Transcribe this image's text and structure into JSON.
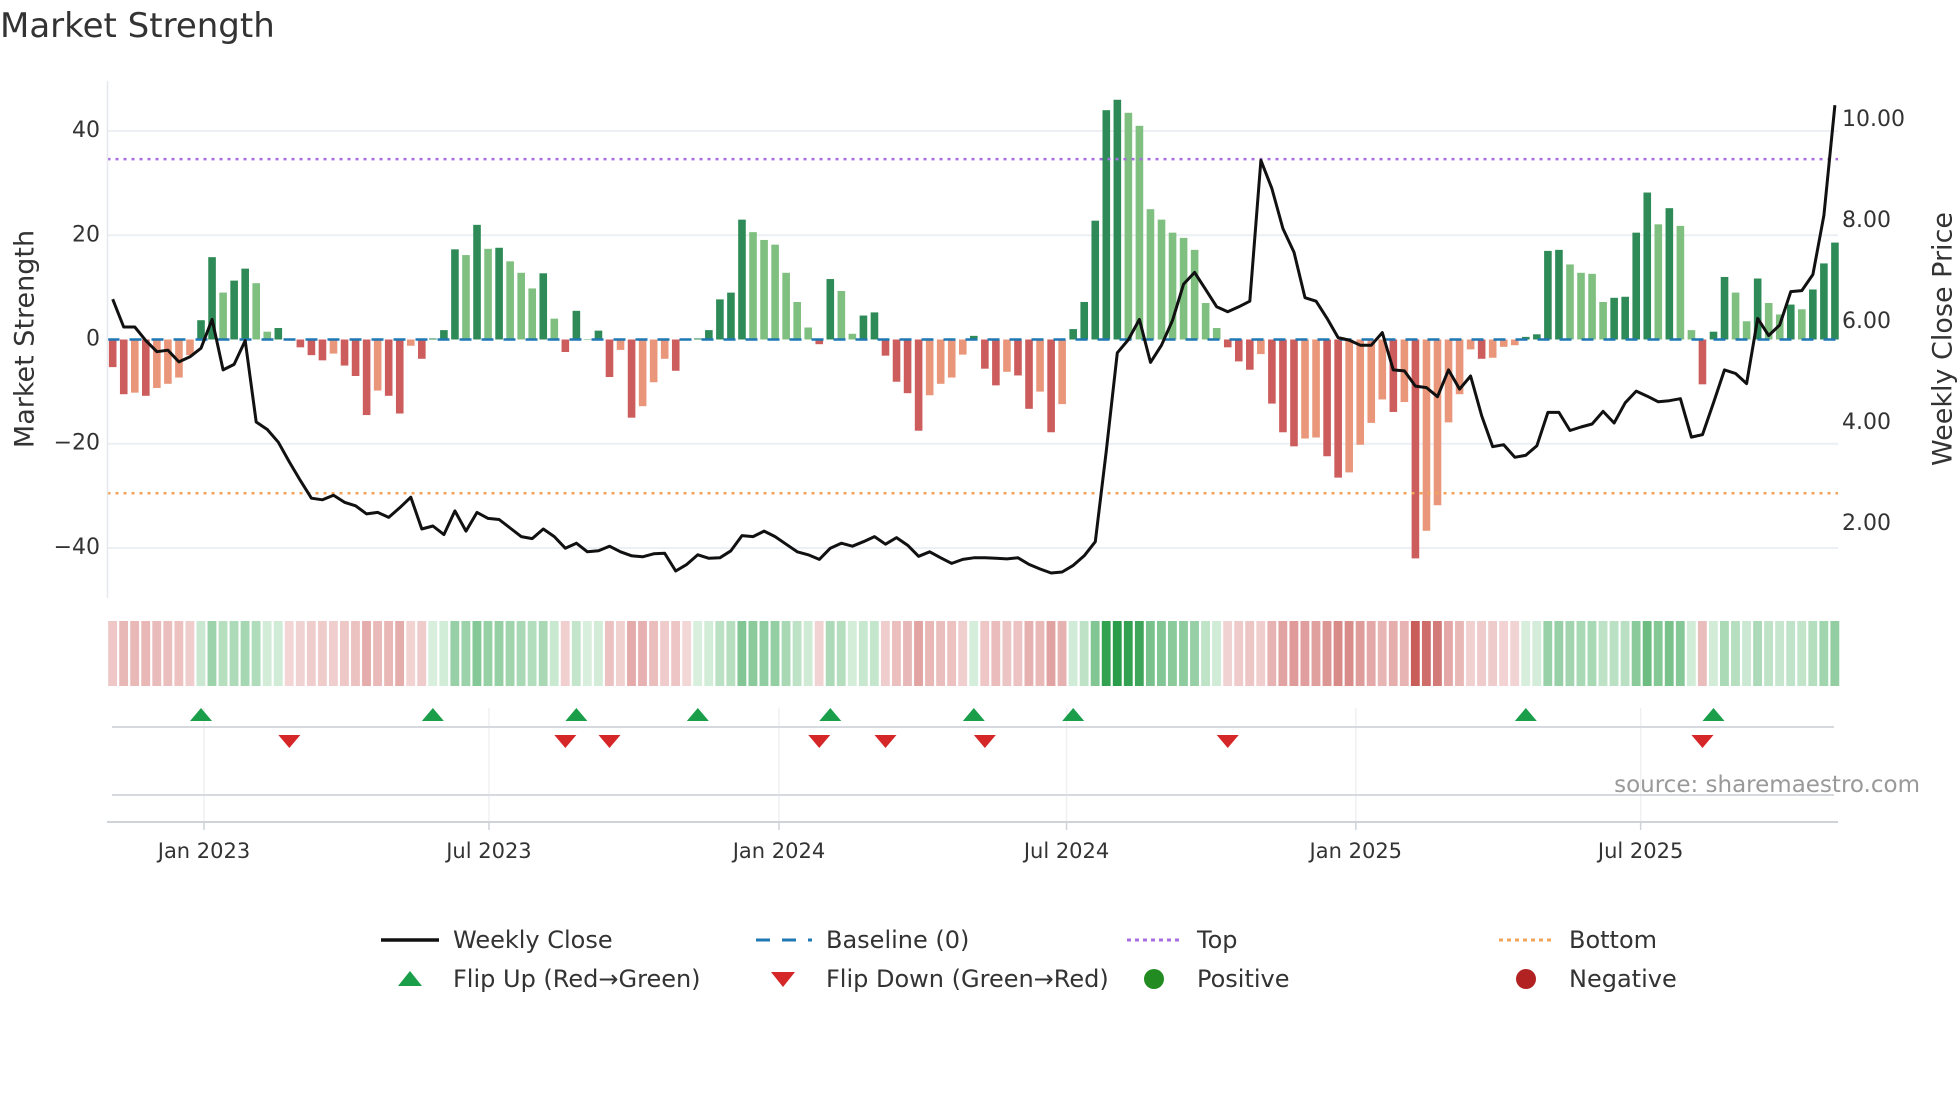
{
  "chart_data": {
    "type": "bar",
    "title": "Market Strength",
    "ylabel": "Market Strength",
    "y2label": "Weekly Close Price",
    "ylim": [
      -49.6,
      49.6
    ],
    "y2lim": [
      0.535,
      10.77
    ],
    "yticks": [
      40,
      20,
      0,
      -20,
      -40
    ],
    "ytick_labels": [
      "40",
      "20",
      "0",
      "−20",
      "−40"
    ],
    "y2ticks": [
      10,
      8,
      6,
      4,
      2
    ],
    "y2tick_labels": [
      "10.00",
      "8.00",
      "6.00",
      "4.00",
      "2.00"
    ],
    "x_unit": "week index (0 = first week shown)",
    "x_ticks": [
      {
        "label": "Jan 2023",
        "week": 8.27
      },
      {
        "label": "Jul 2023",
        "week": 34.08
      },
      {
        "label": "Jan 2024",
        "week": 60.35
      },
      {
        "label": "Jul 2024",
        "week": 86.4
      },
      {
        "label": "Jan 2025",
        "week": 112.6
      },
      {
        "label": "Jul 2025",
        "week": 138.4
      }
    ],
    "top_level": 34.6,
    "bottom_level": -29.5,
    "baseline": 0,
    "strength": [
      -5.3,
      -10.5,
      -10.2,
      -10.8,
      -9.3,
      -8.5,
      -7.3,
      -3,
      3.7,
      15.8,
      9,
      11.3,
      13.6,
      10.8,
      1.5,
      2.2,
      -0.2,
      -1.5,
      -3,
      -4,
      -2.7,
      -5,
      -7,
      -14.5,
      -9.8,
      -10.8,
      -14.2,
      -1.2,
      -3.7,
      0.2,
      1.8,
      17.3,
      16.2,
      22,
      17.4,
      17.6,
      15,
      12.8,
      9.8,
      12.7,
      4,
      -2.4,
      5.5,
      0.1,
      1.7,
      -7.2,
      -2,
      -15,
      -12.8,
      -8.2,
      -3.7,
      -6,
      -0.1,
      0.2,
      1.8,
      7.7,
      9,
      23,
      20.6,
      19.1,
      18.2,
      12.8,
      7.2,
      2.3,
      -0.9,
      11.6,
      9.3,
      1.1,
      4.6,
      5.2,
      -3.1,
      -8.1,
      -10.3,
      -17.5,
      -10.7,
      -8.5,
      -7.3,
      -2.9,
      0.7,
      -5.6,
      -8.8,
      -6.2,
      -6.9,
      -13.3,
      -10,
      -17.8,
      -12.4,
      2,
      7.2,
      22.8,
      44,
      46,
      43.5,
      41,
      25,
      23,
      20.5,
      19.5,
      17.2,
      7,
      2.2,
      -1.5,
      -4.2,
      -5.8,
      -2.8,
      -12.3,
      -17.8,
      -20.5,
      -19,
      -18.8,
      -22.4,
      -26.5,
      -25.5,
      -20.2,
      -16,
      -11.5,
      -13.9,
      -12,
      -42,
      -36.7,
      -31.8,
      -15.9,
      -10.5,
      -1.9,
      -3.7,
      -3.5,
      -1.4,
      -1.1,
      0.5,
      1,
      17,
      17.2,
      14.4,
      12.8,
      12.6,
      7.2,
      8,
      8.2,
      20.5,
      28.2,
      22.1,
      25.2,
      21.8,
      1.8,
      -8.6,
      1.5,
      12,
      9,
      3.5,
      11.7,
      7,
      4.8,
      6.7,
      5.8,
      9.6,
      14.6,
      18.6
    ],
    "weekly_close": [
      6.45,
      5.9,
      5.9,
      5.63,
      5.41,
      5.44,
      5.21,
      5.31,
      5.48,
      6.05,
      5.05,
      5.16,
      5.63,
      4.02,
      3.87,
      3.62,
      3.23,
      2.86,
      2.51,
      2.48,
      2.57,
      2.43,
      2.36,
      2.2,
      2.23,
      2.13,
      2.32,
      2.53,
      1.9,
      1.96,
      1.79,
      2.26,
      1.86,
      2.23,
      2.11,
      2.09,
      1.92,
      1.75,
      1.71,
      1.9,
      1.75,
      1.52,
      1.62,
      1.45,
      1.47,
      1.56,
      1.45,
      1.37,
      1.35,
      1.41,
      1.42,
      1.07,
      1.2,
      1.39,
      1.32,
      1.33,
      1.47,
      1.77,
      1.75,
      1.86,
      1.75,
      1.6,
      1.45,
      1.39,
      1.3,
      1.52,
      1.62,
      1.56,
      1.65,
      1.75,
      1.6,
      1.73,
      1.58,
      1.36,
      1.45,
      1.33,
      1.22,
      1.3,
      1.33,
      1.33,
      1.32,
      1.31,
      1.33,
      1.2,
      1.11,
      1.03,
      1.05,
      1.18,
      1.37,
      1.65,
      3.45,
      5.39,
      5.65,
      6.05,
      5.2,
      5.54,
      6.03,
      6.75,
      6.98,
      6.64,
      6.3,
      6.2,
      6.3,
      6.41,
      9.2,
      8.64,
      7.85,
      7.38,
      6.48,
      6.41,
      6.07,
      5.69,
      5.64,
      5.54,
      5.54,
      5.79,
      5.05,
      5.03,
      4.73,
      4.7,
      4.52,
      5.05,
      4.67,
      4.93,
      4.14,
      3.53,
      3.57,
      3.32,
      3.36,
      3.55,
      4.21,
      4.21,
      3.85,
      3.92,
      3.98,
      4.23,
      4.0,
      4.4,
      4.63,
      4.53,
      4.42,
      4.44,
      4.48,
      3.72,
      3.77,
      4.4,
      5.05,
      4.98,
      4.78,
      6.07,
      5.73,
      5.94,
      6.6,
      6.62,
      6.94,
      8.11,
      10.29
    ],
    "flip_up_weeks": [
      8,
      29,
      42,
      53,
      65,
      78,
      87,
      128,
      145
    ],
    "flip_down_weeks": [
      16,
      41,
      45,
      64,
      70,
      79,
      101,
      144
    ],
    "legend_position": "bottom",
    "legend": [
      {
        "key": "weekly_close",
        "label": "Weekly Close"
      },
      {
        "key": "baseline",
        "label": "Baseline (0)"
      },
      {
        "key": "top",
        "label": "Top"
      },
      {
        "key": "bottom",
        "label": "Bottom"
      },
      {
        "key": "flip_up",
        "label": "Flip Up (Red→Green)"
      },
      {
        "key": "flip_down",
        "label": "Flip Down (Green→Red)"
      },
      {
        "key": "positive",
        "label": "Positive"
      },
      {
        "key": "negative",
        "label": "Negative"
      }
    ],
    "source": "source: sharemaestro.com",
    "colors": {
      "pos_rising": "#2e8b57",
      "pos_falling": "#7fbf7f",
      "neg_falling": "#cd5c5c",
      "neg_rising": "#e9967a",
      "line": "#111111",
      "baseline": "#1f77b4",
      "top": "#a66ee0",
      "bottom": "#f0a45c",
      "flip_up": "#1a9e4a",
      "flip_down": "#d62728",
      "positive": "#228b22",
      "negative": "#b22222"
    }
  }
}
